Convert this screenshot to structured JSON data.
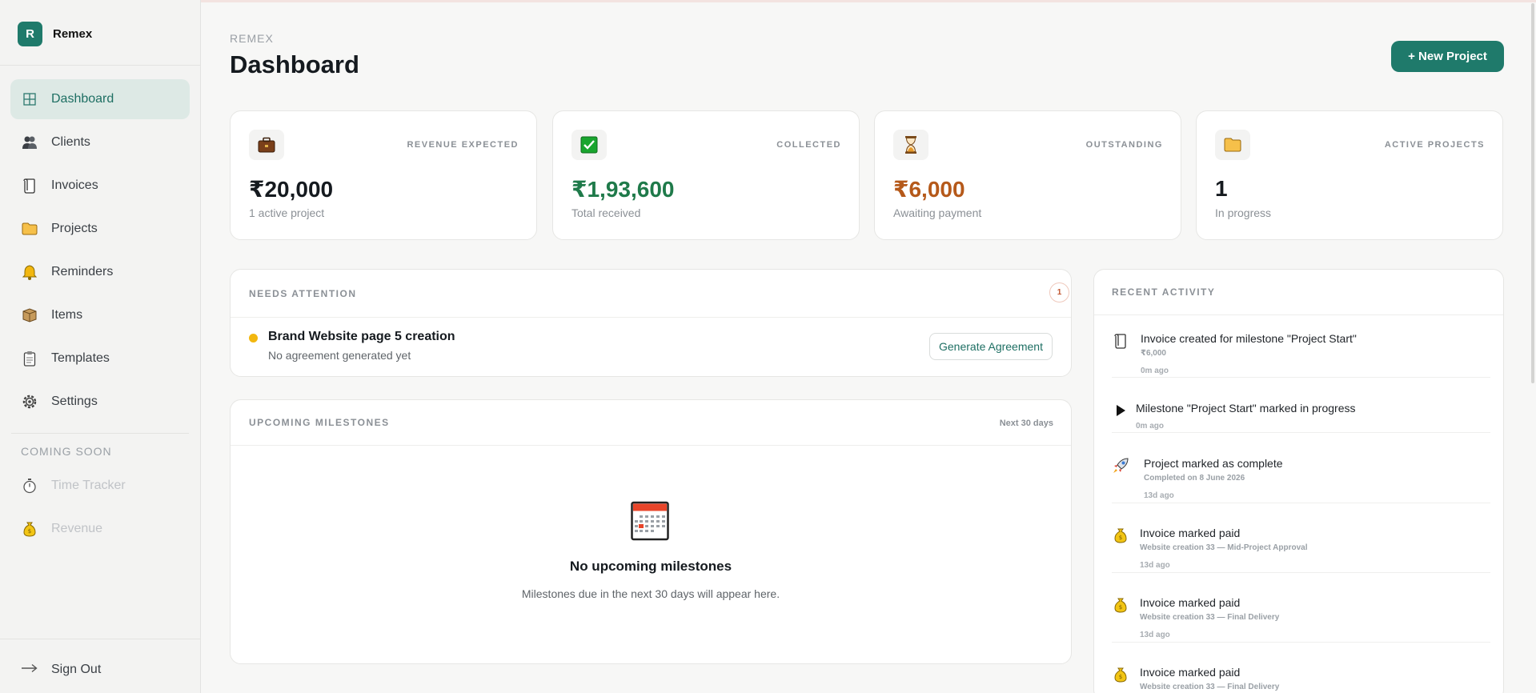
{
  "app": {
    "logo_letter": "R",
    "name": "Remex"
  },
  "sidebar": {
    "items": [
      {
        "label": "Dashboard",
        "icon": "dashboard-grid-icon",
        "active": true
      },
      {
        "label": "Clients",
        "icon": "people-icon"
      },
      {
        "label": "Invoices",
        "icon": "scroll-icon"
      },
      {
        "label": "Projects",
        "icon": "folder-icon"
      },
      {
        "label": "Reminders",
        "icon": "bell-icon"
      },
      {
        "label": "Items",
        "icon": "box-icon"
      },
      {
        "label": "Templates",
        "icon": "clipboard-icon"
      },
      {
        "label": "Settings",
        "icon": "gear-icon"
      }
    ],
    "coming_soon_label": "COMING SOON",
    "coming_soon_items": [
      {
        "label": "Time Tracker",
        "icon": "stopwatch-icon"
      },
      {
        "label": "Revenue",
        "icon": "money-bag-icon"
      }
    ],
    "sign_out": {
      "label": "Sign Out",
      "icon": "arrow-right-icon"
    }
  },
  "header": {
    "breadcrumb": "REMEX",
    "title": "Dashboard",
    "new_project_label": "+ New Project"
  },
  "stats": [
    {
      "label": "REVENUE EXPECTED",
      "value": "₹20,000",
      "sub": "1 active project",
      "icon": "briefcase-icon",
      "value_color": "#151a1f"
    },
    {
      "label": "COLLECTED",
      "value": "₹1,93,600",
      "sub": "Total received",
      "icon": "check-box-icon",
      "value_color": "#1f7a4a"
    },
    {
      "label": "OUTSTANDING",
      "value": "₹6,000",
      "sub": "Awaiting payment",
      "icon": "hourglass-icon",
      "value_color": "#b5591a"
    },
    {
      "label": "ACTIVE PROJECTS",
      "value": "1",
      "sub": "In progress",
      "icon": "folder-icon",
      "value_color": "#151a1f"
    }
  ],
  "needs_attention": {
    "title": "NEEDS ATTENTION",
    "count": "1",
    "item": {
      "title": "Brand Website page 5 creation",
      "subtitle": "No agreement generated yet",
      "action_label": "Generate Agreement"
    }
  },
  "milestones": {
    "title": "UPCOMING MILESTONES",
    "range_label": "Next 30 days",
    "empty_title": "No upcoming milestones",
    "empty_text": "Milestones due in the next 30 days will appear here.",
    "empty_icon": "calendar-icon"
  },
  "activity": {
    "title": "RECENT ACTIVITY",
    "items": [
      {
        "icon": "scroll-icon",
        "title": "Invoice created for milestone \"Project Start\"",
        "detail": "₹6,000",
        "time": "0m ago"
      },
      {
        "icon": "play-icon",
        "title": "Milestone \"Project Start\" marked in progress",
        "detail": "",
        "time": "0m ago"
      },
      {
        "icon": "rocket-icon",
        "title": "Project marked as complete",
        "detail": "Completed on 8 June 2026",
        "time": "13d ago"
      },
      {
        "icon": "money-bag-icon",
        "title": "Invoice marked paid",
        "detail": "Website creation 33 — Mid-Project Approval",
        "time": "13d ago"
      },
      {
        "icon": "money-bag-icon",
        "title": "Invoice marked paid",
        "detail": "Website creation 33 — Final Delivery",
        "time": "13d ago"
      },
      {
        "icon": "money-bag-icon",
        "title": "Invoice marked paid",
        "detail": "Website creation 33 — Final Delivery",
        "time": ""
      }
    ]
  },
  "colors": {
    "accent": "#1f7a6b",
    "active_nav_bg": "#dde9e5"
  }
}
